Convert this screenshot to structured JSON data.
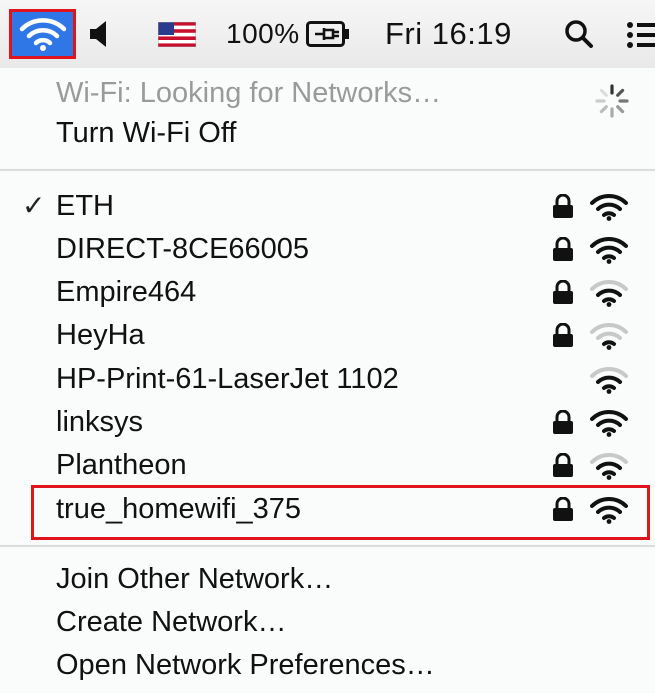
{
  "menubar": {
    "battery_percent": "100%",
    "clock": "Fri 16:19",
    "icons": [
      "wifi-icon",
      "speaker-icon",
      "us-flag-icon",
      "battery-charging-icon",
      "search-icon",
      "list-icon"
    ]
  },
  "wifi_menu": {
    "status": "Wi-Fi: Looking for Networks…",
    "toggle": "Turn Wi-Fi Off",
    "networks": [
      {
        "name": "ETH",
        "connected": true,
        "locked": true,
        "signal": 3
      },
      {
        "name": "DIRECT-8CE66005",
        "connected": false,
        "locked": true,
        "signal": 3
      },
      {
        "name": "Empire464",
        "connected": false,
        "locked": true,
        "signal": 2
      },
      {
        "name": "HeyHa",
        "connected": false,
        "locked": true,
        "signal": 1
      },
      {
        "name": "HP-Print-61-LaserJet 1102",
        "connected": false,
        "locked": false,
        "signal": 2
      },
      {
        "name": "linksys",
        "connected": false,
        "locked": true,
        "signal": 3
      },
      {
        "name": "Plantheon",
        "connected": false,
        "locked": true,
        "signal": 2
      },
      {
        "name": "true_homewifi_375",
        "connected": false,
        "locked": true,
        "signal": 3,
        "highlighted": true
      }
    ],
    "check_mark": "✓",
    "join_other": "Join Other Network…",
    "create": "Create Network…",
    "preferences": "Open Network Preferences…"
  },
  "colors": {
    "accent": "#2f77e6",
    "highlight_border": "#e0141c"
  }
}
